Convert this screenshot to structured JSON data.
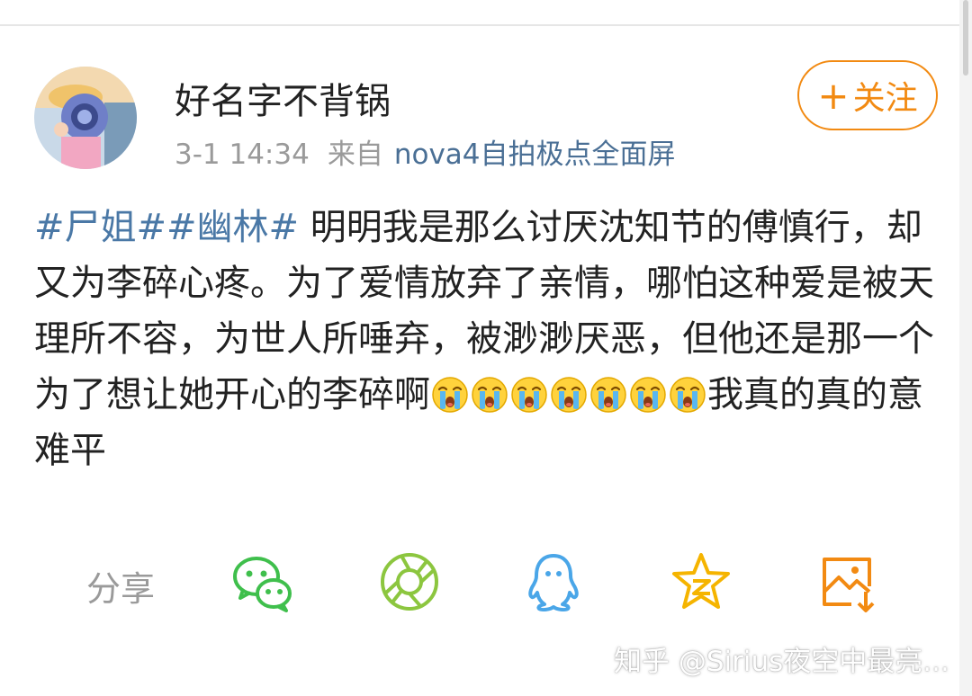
{
  "post": {
    "username": "好名字不背锅",
    "time": "3-1 14:34",
    "from_label": "来自",
    "device": "nova4自拍极点全面屏",
    "follow_plus": "+",
    "follow_label": "关注",
    "content": {
      "topic1": "#尸姐#",
      "topic2": "#幽林#",
      "body": " 明明我是那么讨厌沈知节的傅慎行，却又为李碎心疼。为了爱情放弃了亲情，哪怕这种爱是被天理所不容，为世人所唾弃，被渺渺厌恶，但他还是那一个为了想让她开心的李碎啊",
      "emoji_name": "crying-face-icon",
      "emoji_count": 7,
      "ending": "我真的真的意难平"
    }
  },
  "share": {
    "label": "分享",
    "targets": [
      "wechat-icon",
      "moments-icon",
      "qq-icon",
      "qzone-icon",
      "save-image-icon"
    ]
  },
  "watermark": "知乎 @Sirius夜空中最亮...",
  "colors": {
    "accent": "#f28a12",
    "link": "#4a78a6",
    "wechat": "#3fbf4c",
    "moments": "#8cc63f",
    "qq": "#4aa6e8",
    "qzone": "#f5b400"
  }
}
